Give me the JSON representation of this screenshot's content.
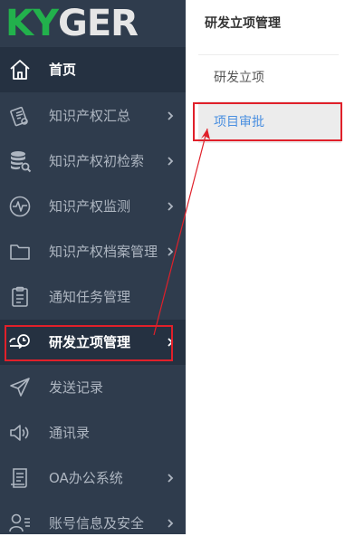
{
  "logo": {
    "text": "KYGER",
    "letters": [
      "K",
      "Y",
      "G",
      "E",
      "R"
    ]
  },
  "sidebar": {
    "items": [
      {
        "label": "首页",
        "icon": "home-icon",
        "has_submenu": false
      },
      {
        "label": "知识产权汇总",
        "icon": "certificate-icon",
        "has_submenu": true
      },
      {
        "label": "知识产权初检索",
        "icon": "database-search-icon",
        "has_submenu": true
      },
      {
        "label": "知识产权监测",
        "icon": "pulse-monitor-icon",
        "has_submenu": true
      },
      {
        "label": "知识产权档案管理",
        "icon": "folder-icon",
        "has_submenu": true
      },
      {
        "label": "通知任务管理",
        "icon": "clipboard-icon",
        "has_submenu": false
      },
      {
        "label": "研发立项管理",
        "icon": "rd-clock-icon",
        "has_submenu": true
      },
      {
        "label": "发送记录",
        "icon": "send-icon",
        "has_submenu": false
      },
      {
        "label": "通讯录",
        "icon": "speaker-icon",
        "has_submenu": false
      },
      {
        "label": "OA办公系统",
        "icon": "document-icon",
        "has_submenu": true
      },
      {
        "label": "账号信息及安全",
        "icon": "user-list-icon",
        "has_submenu": true
      }
    ],
    "active_index": 6
  },
  "submenu": {
    "title": "研发立项管理",
    "items": [
      {
        "label": "研发立项"
      },
      {
        "label": "项目审批"
      }
    ],
    "selected_index": 1
  },
  "colors": {
    "sidebar_bg": "#2f3c4d",
    "sidebar_active_bg": "#253141",
    "menu_text": "#aeb6c1",
    "logo_green": "#22b14c",
    "logo_white": "#e6e6e6",
    "submenu_selected_text": "#4a8fe0",
    "annotation_red": "#e0202a"
  }
}
